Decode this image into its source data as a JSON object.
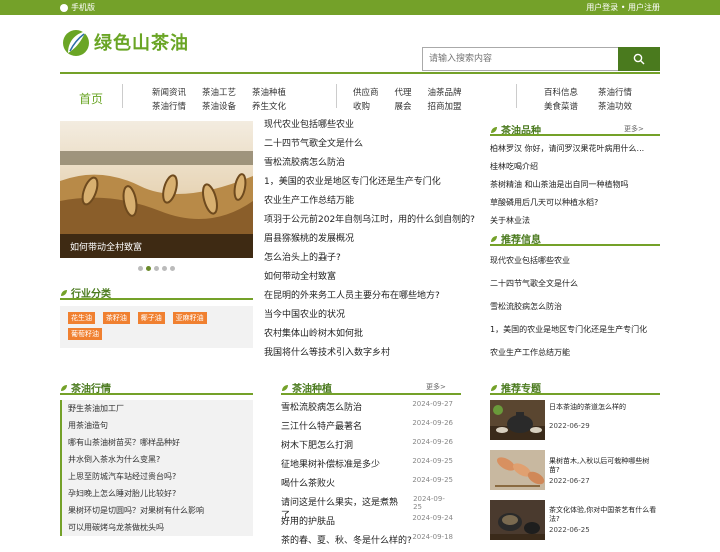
{
  "topbar": {
    "mobile": "手机版",
    "login": "用户登录",
    "dot": "•",
    "register": "用户注册"
  },
  "logo": {
    "text": "绿色山茶油"
  },
  "search": {
    "placeholder": "请输入搜索内容"
  },
  "nav": {
    "home": "首页",
    "group1": [
      "新闻资讯",
      "茶油工艺",
      "茶油种植",
      "茶油行情",
      "茶油设备",
      "养生文化"
    ],
    "group2": [
      "供应商",
      "代理",
      "油茶品牌",
      "收购",
      "展会",
      "招商加盟"
    ],
    "group3": [
      "百科信息",
      "茶油行情",
      "美食菜谱",
      "茶油功效"
    ]
  },
  "slider": {
    "caption": "如何带动全村致富"
  },
  "industry": {
    "title": "行业分类",
    "tags": [
      "花生油",
      "茶籽油",
      "椰子油",
      "亚麻籽油",
      "葡萄籽油"
    ]
  },
  "news": [
    "现代农业包括哪些农业",
    "二十四节气歌全文是什么",
    "雪松流胶病怎么防治",
    "1，美国的农业是地区专门化还是生产专门化",
    "农业生产工作总结万能",
    "项羽于公元前202年自刎乌江时，用的什么剑自刎的?",
    "眉县猕猴桃的发展概况",
    "怎么治头上的蝨子?",
    "如何带动全村致富",
    "在昆明的外来务工人员主要分布在哪些地方?",
    "当今中国农业的状况",
    "农村集体山岭树木如何批",
    "我国将什么等技术引入数字乡村"
  ],
  "varieties": {
    "title": "茶油品种",
    "more": "更多>",
    "items": [
      "柏林罗汉 你好，请问罗汉果花叶病用什么...",
      "桂林吃喝介绍",
      "茶树精油 和山茶油是出自同一种植物吗",
      "草酸磷用后几天可以种植水稻?",
      "关于林业法"
    ]
  },
  "recommend": {
    "title": "推荐信息",
    "items": [
      "现代农业包括哪些农业",
      "二十四节气歌全文是什么",
      "雪松流胶病怎么防治",
      "1，美国的农业是地区专门化还是生产专门化",
      "农业生产工作总结万能"
    ]
  },
  "market": {
    "title": "茶油行情",
    "items": [
      "野生茶油加工厂",
      "用茶油造句",
      "哪有山茶油树苗买？哪样品种好",
      "井水倒入茶水为什么变黑?",
      "上思至防城汽车站经过贵台吗?",
      "孕妇晚上怎么睡对胎儿比较好?",
      "果树环切是切圆吗？对果树有什么影响",
      "可以用碳烤乌龙茶做枕头吗"
    ]
  },
  "planting": {
    "title": "茶油种植",
    "more": "更多>",
    "rows": [
      {
        "t": "雪松流胶病怎么防治",
        "d": "2024-09-27"
      },
      {
        "t": "三江什么特产最著名",
        "d": "2024-09-26"
      },
      {
        "t": "树木下肥怎么打洞",
        "d": "2024-09-26"
      },
      {
        "t": "征地果树补偿标准是多少",
        "d": "2024-09-25"
      },
      {
        "t": "喝什么茶败火",
        "d": "2024-09-25"
      },
      {
        "t": "请问这是什么果实，这是煮熟了...",
        "d": "2024-09-25"
      },
      {
        "t": "好用的护肤品",
        "d": "2024-09-24"
      },
      {
        "t": "茶的春、夏、秋、冬是什么样的?",
        "d": "2024-09-18"
      }
    ]
  },
  "topics": {
    "title": "推荐专题",
    "items": [
      {
        "t": "日本茶油的茶道怎么样的",
        "d": "2022-06-29"
      },
      {
        "t": "果树苗木,入秋以后可栽种哪些树苗?",
        "d": "2022-06-27"
      },
      {
        "t": "茶文化体验,你对中国茶艺有什么看法?",
        "d": "2022-06-25"
      }
    ]
  },
  "colors": {
    "brand": "#74a129",
    "dark": "#4a7a1e",
    "tag": "#f08030"
  }
}
